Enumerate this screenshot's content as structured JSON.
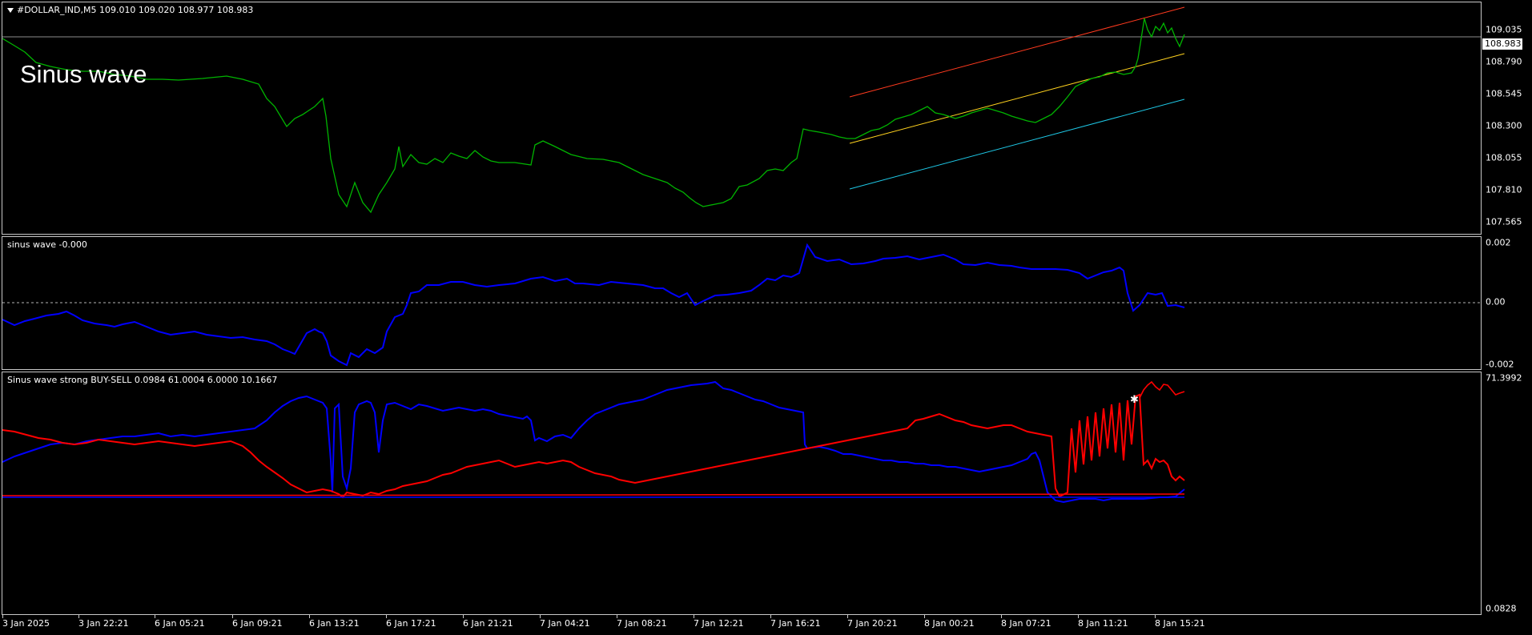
{
  "main": {
    "title": "#DOLLAR_IND,M5  109.010 109.020 108.977 108.983",
    "overlay_label": "Sinus wave",
    "price_levels": [
      "109.035",
      "108.790",
      "108.545",
      "108.300",
      "108.055",
      "107.810",
      "107.565"
    ],
    "current_price": "108.983",
    "colors": {
      "price": "#00b400",
      "upper": "#ff3a1e",
      "middle": "#ffd21e",
      "lower": "#1ec8e6"
    }
  },
  "sub1": {
    "title": "sinus wave -0.000",
    "levels": [
      "0.002",
      "0.00",
      "-0.002"
    ],
    "color": "#0000ff"
  },
  "sub2": {
    "title": "Sinus wave strong BUY-SELL 0.0984 61.0004 6.0000 10.1667",
    "levels": [
      "71.3992",
      "0.0828"
    ],
    "colors": {
      "buy": "#0000ff",
      "sell": "#ff0000"
    }
  },
  "time_axis": [
    "3 Jan 2025",
    "3 Jan 22:21",
    "6 Jan 05:21",
    "6 Jan 09:21",
    "6 Jan 13:21",
    "6 Jan 17:21",
    "6 Jan 21:21",
    "7 Jan 04:21",
    "7 Jan 08:21",
    "7 Jan 12:21",
    "7 Jan 16:21",
    "7 Jan 20:21",
    "8 Jan 00:21",
    "8 Jan 07:21",
    "8 Jan 11:21",
    "8 Jan 15:21"
  ]
}
